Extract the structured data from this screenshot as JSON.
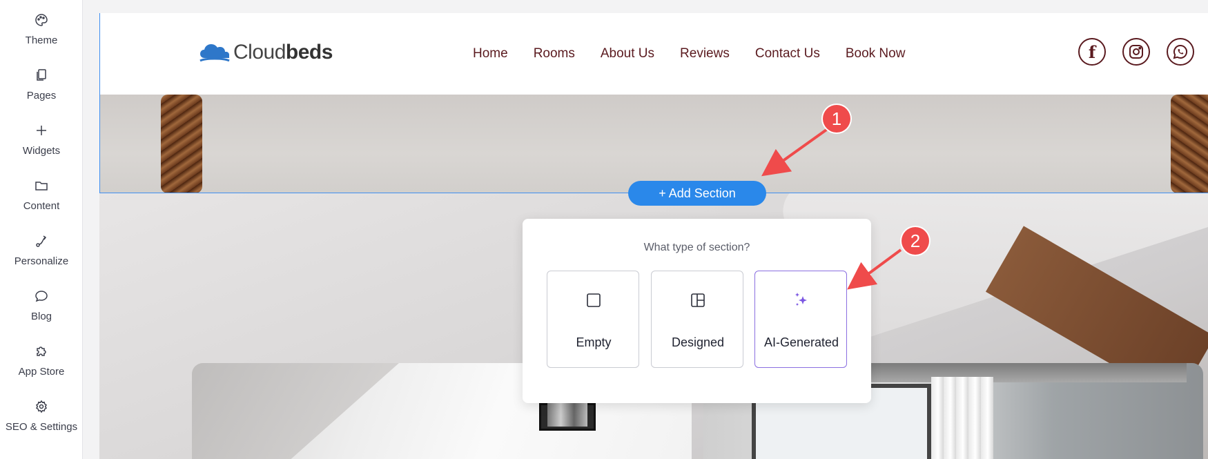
{
  "sidebar": {
    "items": [
      {
        "label": "Theme",
        "icon": "palette-icon"
      },
      {
        "label": "Pages",
        "icon": "pages-icon"
      },
      {
        "label": "Widgets",
        "icon": "plus-icon"
      },
      {
        "label": "Content",
        "icon": "folder-icon"
      },
      {
        "label": "Personalize",
        "icon": "personalize-icon"
      },
      {
        "label": "Blog",
        "icon": "chat-bubble-icon"
      },
      {
        "label": "App Store",
        "icon": "puzzle-icon"
      },
      {
        "label": "SEO & Settings",
        "icon": "gear-icon"
      }
    ]
  },
  "site": {
    "logo": {
      "light": "Cloud",
      "bold": "beds"
    },
    "nav": [
      "Home",
      "Rooms",
      "About Us",
      "Reviews",
      "Contact Us",
      "Book Now"
    ],
    "social": [
      {
        "icon": "facebook-icon",
        "glyph": "f"
      },
      {
        "icon": "instagram-icon"
      },
      {
        "icon": "whatsapp-icon"
      }
    ],
    "brand_color": "#5a1a1f"
  },
  "editor": {
    "add_section_label": "+ Add Section",
    "accent": "#2a88ea",
    "popup": {
      "title": "What type of section?",
      "options": [
        {
          "label": "Empty",
          "icon": "square-icon"
        },
        {
          "label": "Designed",
          "icon": "layout-icon"
        },
        {
          "label": "AI-Generated",
          "icon": "sparkles-icon",
          "highlighted": true
        }
      ]
    }
  },
  "annotations": {
    "callouts": [
      "1",
      "2"
    ],
    "color": "#ef4b4b"
  }
}
